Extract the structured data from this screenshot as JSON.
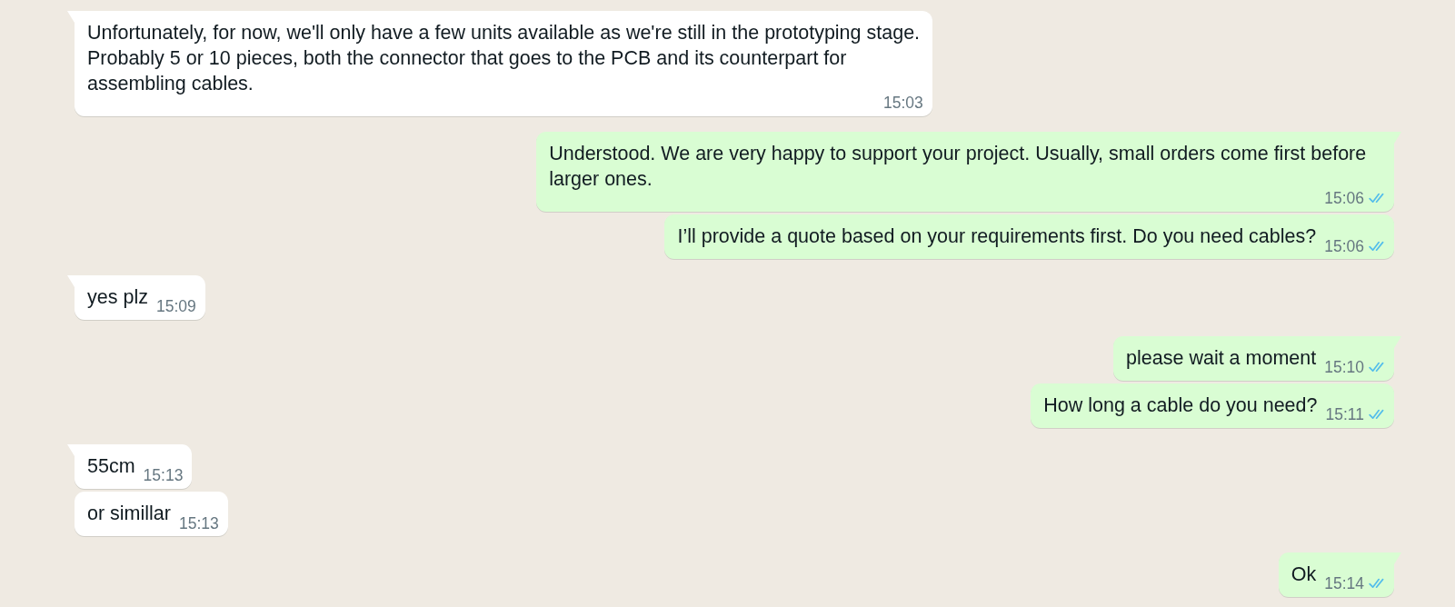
{
  "messages": [
    {
      "kind": "incoming",
      "tail": true,
      "text": "Unfortunately, for now, we'll only have a few units available as we're still in the prototyping stage. Probably 5 or 10 pieces, both the connector that goes to the PCB and its counterpart for assembling cables.",
      "time": "15:03"
    },
    {
      "kind": "outgoing",
      "tail": true,
      "text": "Understood. We are very happy to support your project. Usually, small orders come first before larger ones.",
      "time": "15:06",
      "read": true
    },
    {
      "kind": "outgoing",
      "tail": false,
      "text": "I’ll provide a quote based on your requirements first. Do you need cables?",
      "time": "15:06",
      "read": true
    },
    {
      "kind": "incoming",
      "tail": true,
      "text": "yes plz",
      "time": "15:09"
    },
    {
      "kind": "outgoing",
      "tail": true,
      "text": "please wait a moment",
      "time": "15:10",
      "read": true
    },
    {
      "kind": "outgoing",
      "tail": false,
      "text": "How long a cable do you need?",
      "time": "15:11",
      "read": true
    },
    {
      "kind": "incoming",
      "tail": true,
      "text": "55cm",
      "time": "15:13"
    },
    {
      "kind": "incoming",
      "tail": false,
      "text": "or simillar",
      "time": "15:13"
    },
    {
      "kind": "outgoing",
      "tail": true,
      "text": "Ok",
      "time": "15:14",
      "read": true
    }
  ]
}
